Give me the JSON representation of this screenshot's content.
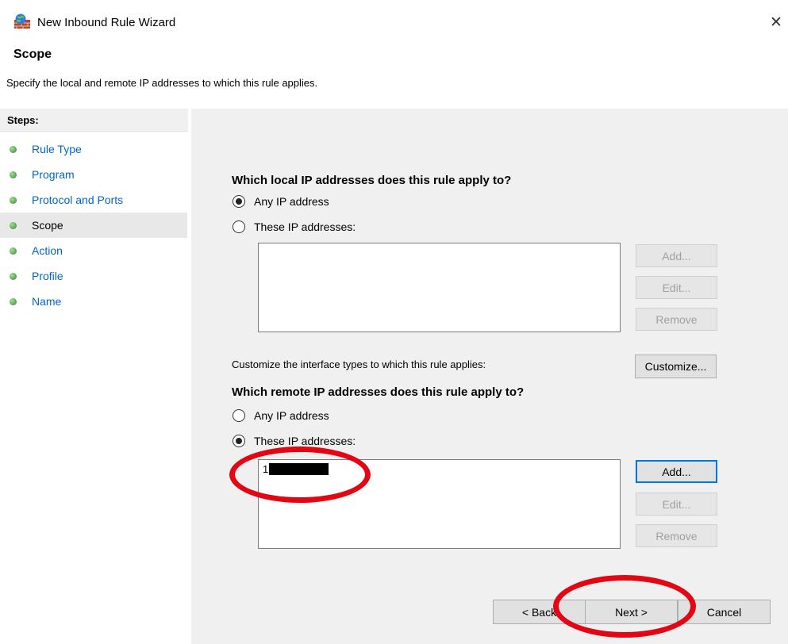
{
  "window": {
    "title": "New Inbound Rule Wizard",
    "close_glyph": "✕",
    "icon": "firewall-icon"
  },
  "page": {
    "heading": "Scope",
    "description": "Specify the local and remote IP addresses to which this rule applies."
  },
  "steps": {
    "header": "Steps:",
    "items": [
      {
        "label": "Rule Type"
      },
      {
        "label": "Program"
      },
      {
        "label": "Protocol and Ports"
      },
      {
        "label": "Scope",
        "current": true
      },
      {
        "label": "Action"
      },
      {
        "label": "Profile"
      },
      {
        "label": "Name"
      }
    ]
  },
  "local": {
    "question": "Which local IP addresses does this rule apply to?",
    "any_label": "Any IP address",
    "these_label": "These IP addresses:",
    "selected": "any",
    "add": "Add...",
    "edit": "Edit...",
    "remove": "Remove"
  },
  "customize": {
    "text": "Customize the interface types to which this rule applies:",
    "button": "Customize..."
  },
  "remote": {
    "question": "Which remote IP addresses does this rule apply to?",
    "any_label": "Any IP address",
    "these_label": "These IP addresses:",
    "selected": "these",
    "entry_visible": "1",
    "add": "Add...",
    "edit": "Edit...",
    "remove": "Remove"
  },
  "footer": {
    "back": "< Back",
    "next": "Next >",
    "cancel": "Cancel"
  },
  "colors": {
    "link": "#0066cc",
    "annotation": "#e30613",
    "panel": "#f0f0f0"
  }
}
